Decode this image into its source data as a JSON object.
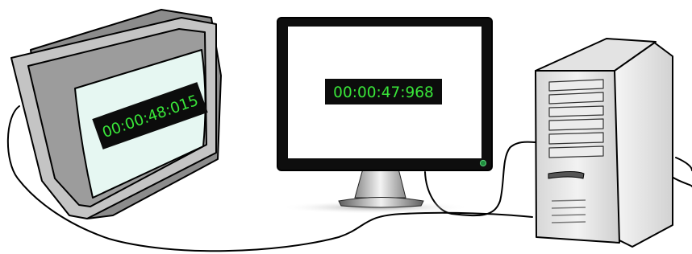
{
  "displays": {
    "crt_monitor": {
      "time": "00:00:48:015"
    },
    "lcd_monitor": {
      "time": "00:00:47:968"
    }
  },
  "colors": {
    "timer_background": "#0c0c0c",
    "timer_text": "#39e639",
    "crt_screen": "#e6f7f2",
    "crt_case": "#8c8c8c",
    "lcd_bezel": "#0e0e0e",
    "tower_case": "#e3e3e3",
    "cable": "#000000"
  },
  "icons": {
    "crt": "crt-monitor-icon",
    "lcd": "lcd-monitor-icon",
    "tower": "desktop-tower-icon",
    "power": "power-led-icon"
  }
}
